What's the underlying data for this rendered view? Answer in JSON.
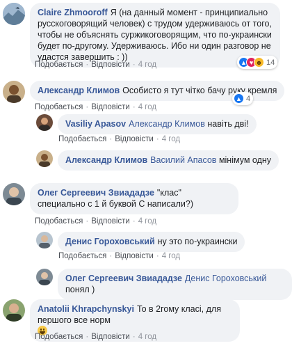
{
  "actions": {
    "like": "Подобається",
    "reply": "Відповісти",
    "sep": "·"
  },
  "comments": [
    {
      "author": "Claire Zhmooroff",
      "text": "Я (на данный момент - принципиально русскоговорящий человек) с трудом удерживаюсь от того, чтобы не объяснять суржикоговорящим, что по-украински будет по-другому. Удерживаюсь. Ибо ни один разговор не удастся завершить : ))",
      "time": "4 год",
      "reaction_count": "14"
    },
    {
      "author": "Александр Климов",
      "text": "Особисто я тут чітко бачу руку кремля",
      "time": "4 год",
      "reaction_count": "4"
    },
    {
      "author": "Vasiliy Apasov",
      "mention": "Александр Климов",
      "text": "навіть дві!",
      "time": "4 год"
    },
    {
      "author": "Александр Климов",
      "mention": "Василий Апасов",
      "text": "мінімум одну",
      "time": "4 год"
    },
    {
      "author": "Олег Сергеевич Звиададзе",
      "text": "\"клас\" специально с 1 й буквой С написали?)",
      "time": "4 год"
    },
    {
      "author": "Денис Гороховський",
      "text": "ну это по-украински",
      "time": "4 год"
    },
    {
      "author": "Олег Сергеевич Звиададзе",
      "mention": "Денис Гороховський",
      "text": "понял )",
      "time": "4 год"
    },
    {
      "author": "Anatolii Khrapchynskyi",
      "text": "То в 2гому класі, для першого все норм",
      "time": "4 год"
    }
  ],
  "colors": {
    "link": "#385898",
    "like": "#1877f2",
    "love": "#e0245e",
    "haha": "#f7b928"
  },
  "icons": {
    "like": "thumbs-up-icon",
    "love": "heart-icon",
    "haha": "laugh-emoji-icon"
  }
}
